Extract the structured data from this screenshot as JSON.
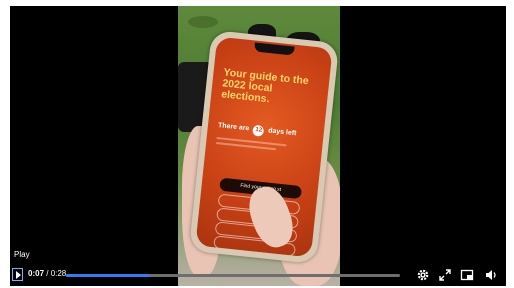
{
  "phone_screen": {
    "title": "Your guide to the 2022 local elections.",
    "days_prefix": "There are",
    "days_count": "12",
    "days_suffix": "days left",
    "buttons": [
      "Find your voting st",
      "",
      "",
      "",
      ""
    ]
  },
  "player": {
    "tooltip": "Play",
    "current_time": "0:07",
    "separator": " / ",
    "duration": "0:28",
    "progress_fraction": 0.25,
    "icons": [
      "play-icon",
      "settings-gear-icon",
      "fullscreen-icon",
      "picture-in-picture-icon",
      "volume-icon"
    ]
  },
  "colors": {
    "accent": "#2f7df0",
    "screen_orange": "#d44a1a",
    "title_yellow": "#ffd76a"
  }
}
